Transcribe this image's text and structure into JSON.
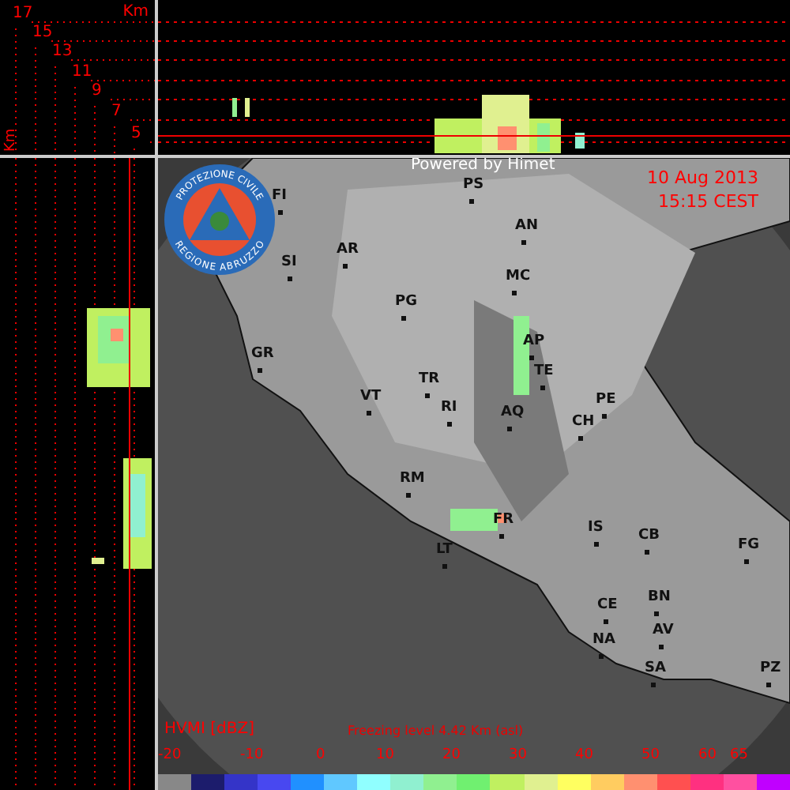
{
  "height_axis": {
    "unit": "Km",
    "labels": [
      "17",
      "15",
      "13",
      "11",
      "9",
      "7",
      "5"
    ]
  },
  "side_unit": "Km",
  "map": {
    "credit": "Powered by Himet",
    "date": "10 Aug 2013",
    "time": "15:15 CEST",
    "logo": {
      "top_text": "PROTEZIONE CIVILE",
      "bottom_text": "REGIONE ABRUZZO"
    },
    "cities": [
      {
        "name": "FI"
      },
      {
        "name": "SI"
      },
      {
        "name": "AR"
      },
      {
        "name": "PS"
      },
      {
        "name": "AN"
      },
      {
        "name": "MC"
      },
      {
        "name": "PG"
      },
      {
        "name": "GR"
      },
      {
        "name": "AP"
      },
      {
        "name": "TE"
      },
      {
        "name": "TR"
      },
      {
        "name": "RI"
      },
      {
        "name": "VT"
      },
      {
        "name": "AQ"
      },
      {
        "name": "PE"
      },
      {
        "name": "CH"
      },
      {
        "name": "RM"
      },
      {
        "name": "FR"
      },
      {
        "name": "LT"
      },
      {
        "name": "IS"
      },
      {
        "name": "CB"
      },
      {
        "name": "FG"
      },
      {
        "name": "CE"
      },
      {
        "name": "BN"
      },
      {
        "name": "NA"
      },
      {
        "name": "AV"
      },
      {
        "name": "SA"
      },
      {
        "name": "PZ"
      }
    ]
  },
  "legend": {
    "title": "HVMI [dBZ]",
    "freezing_level": "Freezing level  4.42 Km (asl)",
    "ticks": [
      "-20",
      "-10",
      "0",
      "10",
      "20",
      "30",
      "40",
      "50",
      "60",
      "65"
    ],
    "colors": [
      {
        "color": "#888888"
      },
      {
        "color": "#1c1c6c"
      },
      {
        "color": "#3434c8"
      },
      {
        "color": "#4848f0"
      },
      {
        "color": "#2090ff"
      },
      {
        "color": "#60c8ff"
      },
      {
        "color": "#90ffff"
      },
      {
        "color": "#90f0d0"
      },
      {
        "color": "#90f090"
      },
      {
        "color": "#70f070"
      },
      {
        "color": "#c0f060"
      },
      {
        "color": "#e0f090"
      },
      {
        "color": "#ffff60"
      },
      {
        "color": "#ffcc60"
      },
      {
        "color": "#ff9070"
      },
      {
        "color": "#ff5050"
      },
      {
        "color": "#ff3080"
      },
      {
        "color": "#ff50a0"
      },
      {
        "color": "#c000ff"
      }
    ]
  }
}
